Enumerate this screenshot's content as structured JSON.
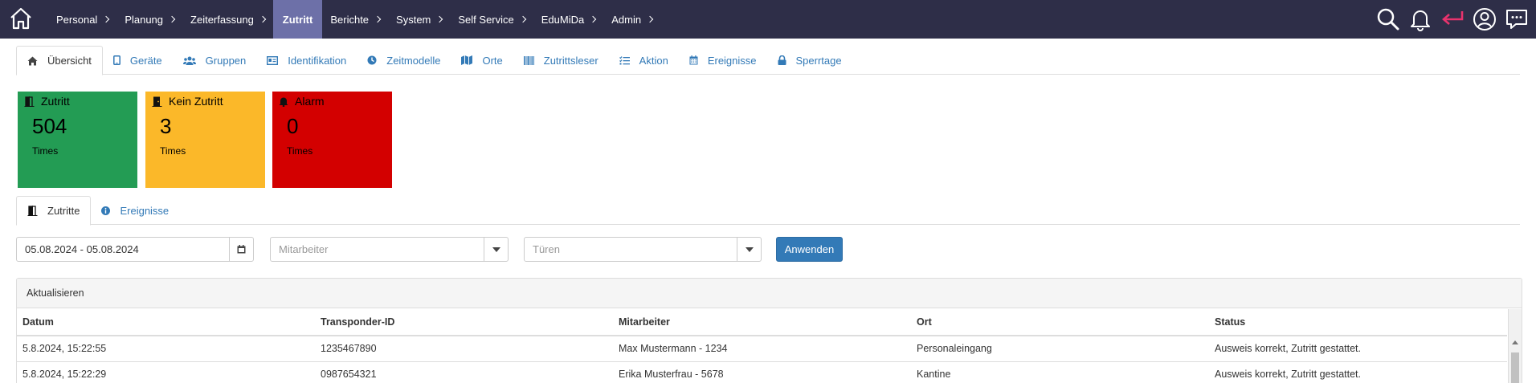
{
  "nav": {
    "items": [
      {
        "label": "Personal",
        "chevron": true
      },
      {
        "label": "Planung",
        "chevron": true
      },
      {
        "label": "Zeiterfassung",
        "chevron": true
      },
      {
        "label": "Zutritt",
        "chevron": false,
        "active": true
      },
      {
        "label": "Berichte",
        "chevron": true
      },
      {
        "label": "System",
        "chevron": true
      },
      {
        "label": "Self Service",
        "chevron": true
      },
      {
        "label": "EduMiDa",
        "chevron": true
      },
      {
        "label": "Admin",
        "chevron": true
      }
    ],
    "icons": [
      "home-icon",
      "search-icon",
      "bell-icon",
      "return-icon",
      "user-circle-icon",
      "chat-icon"
    ]
  },
  "tabs": [
    {
      "label": "Übersicht",
      "icon": "home-icon",
      "active": true
    },
    {
      "label": "Geräte",
      "icon": "tablet-icon"
    },
    {
      "label": "Gruppen",
      "icon": "users-icon"
    },
    {
      "label": "Identifikation",
      "icon": "id-card-icon"
    },
    {
      "label": "Zeitmodelle",
      "icon": "clock-icon"
    },
    {
      "label": "Orte",
      "icon": "map-icon"
    },
    {
      "label": "Zutrittsleser",
      "icon": "barcode-icon"
    },
    {
      "label": "Aktion",
      "icon": "list-icon"
    },
    {
      "label": "Ereignisse",
      "icon": "calendar-icon"
    },
    {
      "label": "Sperrtage",
      "icon": "lock-icon"
    }
  ],
  "cards": [
    {
      "title": "Zutritt",
      "value": "504",
      "unit": "Times",
      "color": "#239c54",
      "icon": "door-open-icon"
    },
    {
      "title": "Kein Zutritt",
      "value": "3",
      "unit": "Times",
      "color": "#fbb829",
      "icon": "door-closed-icon"
    },
    {
      "title": "Alarm",
      "value": "0",
      "unit": "Times",
      "color": "#d30000",
      "icon": "bell-icon"
    }
  ],
  "subtabs": [
    {
      "label": "Zutritte",
      "icon": "door-open-icon",
      "active": true
    },
    {
      "label": "Ereignisse",
      "icon": "info-icon"
    }
  ],
  "filters": {
    "date_range": "05.08.2024 - 05.08.2024",
    "employee_placeholder": "Mitarbeiter",
    "doors_placeholder": "Türen",
    "apply_label": "Anwenden"
  },
  "table": {
    "refresh_label": "Aktualisieren",
    "columns": [
      "Datum",
      "Transponder-ID",
      "Mitarbeiter",
      "Ort",
      "Status"
    ],
    "rows": [
      [
        "5.8.2024, 15:22:55",
        "1235467890",
        "Max Mustermann - 1234",
        "Personaleingang",
        "Ausweis korrekt, Zutritt gestattet."
      ],
      [
        "5.8.2024, 15:22:29",
        "0987654321",
        "Erika Musterfrau - 5678",
        "Kantine",
        "Ausweis korrekt, Zutritt gestattet."
      ]
    ]
  },
  "colors": {
    "nav_bg": "#2e2e48",
    "nav_active": "#6d70a8",
    "link": "#337ab7",
    "return_icon": "#e8336d"
  }
}
